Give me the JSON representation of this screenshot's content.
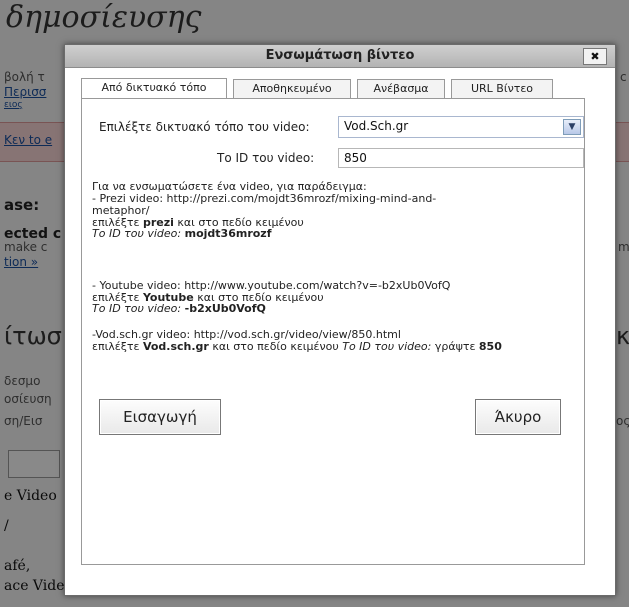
{
  "background": {
    "heading": "δημοσίευσης",
    "texts": [
      {
        "text": "βολή τ",
        "kind": "small"
      },
      {
        "text": "Περισσ",
        "kind": "link"
      },
      {
        "text": "ειος",
        "kind": "link"
      },
      {
        "text": "Κεν to e",
        "kind": "small"
      },
      {
        "text": "ase:",
        "kind": "bold"
      },
      {
        "text": "ected c",
        "kind": "bold"
      },
      {
        "text": "make c",
        "kind": "small"
      },
      {
        "text": "tion »",
        "kind": "link"
      },
      {
        "text": "ίτωσ",
        "kind": "big"
      },
      {
        "text": "δεσμο",
        "kind": "small"
      },
      {
        "text": "οσίευση",
        "kind": "small"
      },
      {
        "text": "ση/Εισ",
        "kind": "small"
      },
      {
        "text": "e Video",
        "kind": "serif"
      },
      {
        "text": "/",
        "kind": "serif"
      },
      {
        "text": "afé,",
        "kind": "serif"
      },
      {
        "text": "ace Video,",
        "kind": "serif"
      },
      {
        "text": "c",
        "kind": "small"
      },
      {
        "text": "m",
        "kind": "small"
      },
      {
        "text": "κ",
        "kind": "big"
      },
      {
        "text": "ος",
        "kind": "small"
      }
    ]
  },
  "dialog": {
    "title": "Ενσωμάτωση βίντεο",
    "close_label": "✖",
    "tabs": [
      {
        "label": "Από δικτυακό τόπο",
        "active": true
      },
      {
        "label": "Αποθηκευμένο",
        "active": false
      },
      {
        "label": "Ανέβασμα",
        "active": false
      },
      {
        "label": "URL Βίντεο",
        "active": false
      }
    ],
    "site_label": "Επιλέξτε δικτυακό τόπο του video:",
    "site_value": "Vod.Sch.gr",
    "id_label": "Το ID του video:",
    "id_value": "850",
    "help": {
      "l1": "Για να ενσωματώσετε ένα video, για παράδειγμα:",
      "l2": "- Prezi video: http://prezi.com/mojdt36mrozf/mixing-mind-and-",
      "l3": "metaphor/",
      "l4a": "επιλέξτε ",
      "l4b": "prezi",
      "l4c": " και στο πεδίο κειμένου",
      "l5a": "Το ID του video: ",
      "l5b": "mojdt36mrozf",
      "l6": "- Youtube video: http://www.youtube.com/watch?v=-b2xUb0VofQ",
      "l7a": "επιλέξτε ",
      "l7b": "Youtube",
      "l7c": " και στο πεδίο κειμένου",
      "l8a": "Το ID του video: ",
      "l8b": "-b2xUb0VofQ",
      "l9": "-Vod.sch.gr video: http://vod.sch.gr/video/view/850.html",
      "l10a": "επιλέξτε ",
      "l10b": "Vod.sch.gr",
      "l10c": " και στο πεδίο κειμένου ",
      "l10d": "Το ID του video:",
      "l10e": " γράψτε ",
      "l10f": "850"
    },
    "insert_label": "Εισαγωγή",
    "cancel_label": "Άκυρο"
  }
}
